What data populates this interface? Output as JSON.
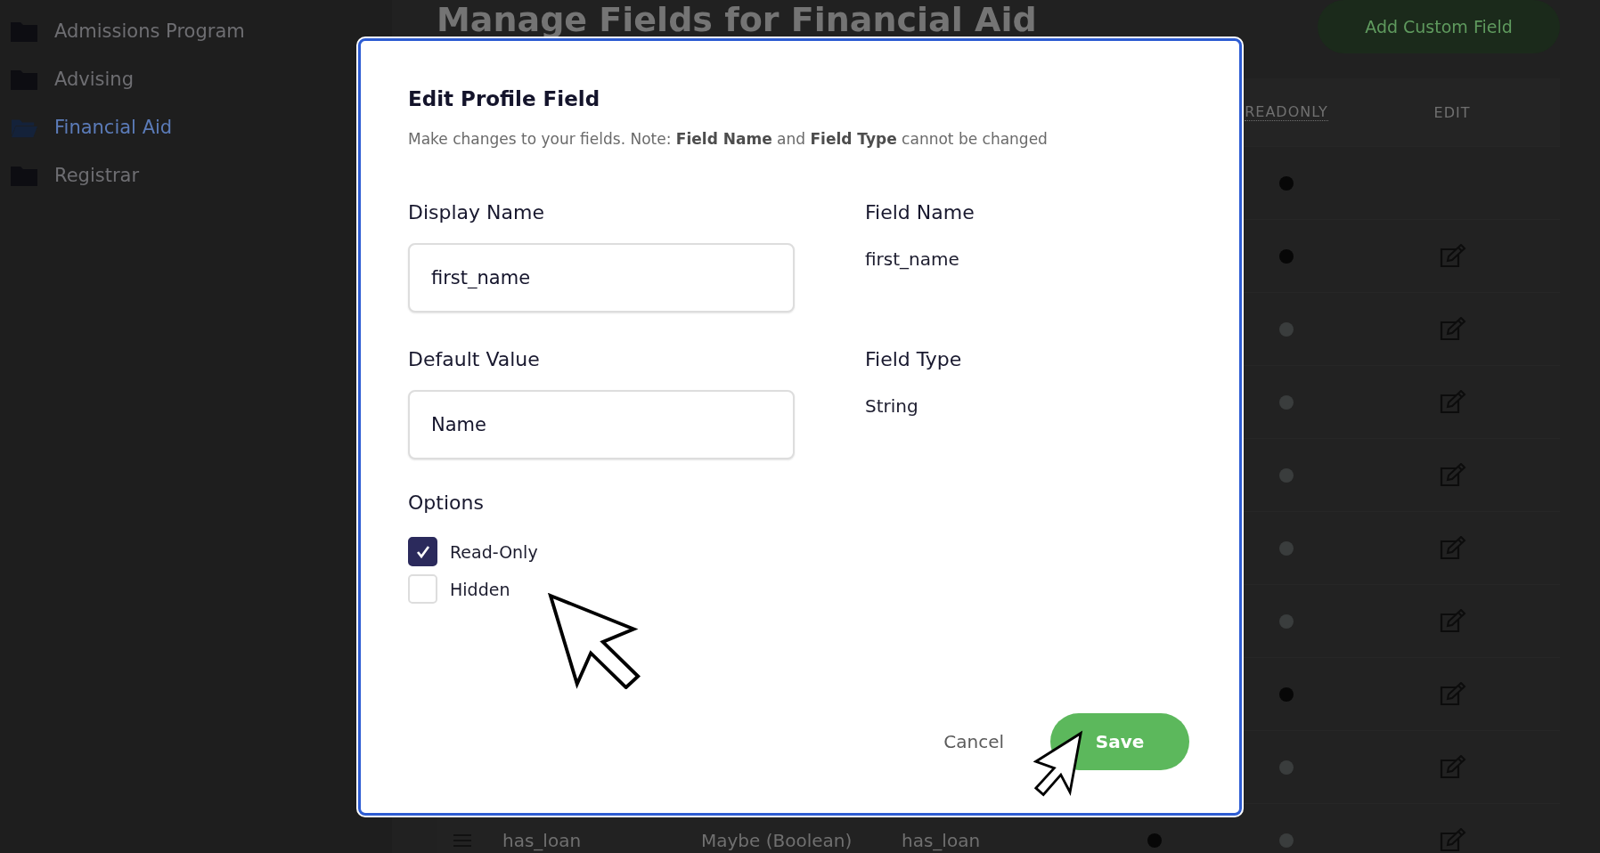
{
  "sidebar": {
    "items": [
      {
        "label": "Admissions Program",
        "selected": false
      },
      {
        "label": "Advising",
        "selected": false
      },
      {
        "label": "Financial Aid",
        "selected": true
      },
      {
        "label": "Registrar",
        "selected": false
      }
    ]
  },
  "page": {
    "title": "Manage Fields for Financial Aid",
    "add_button": "Add Custom Field"
  },
  "table": {
    "columns": [
      {
        "label": "READONLY"
      },
      {
        "label": "EDIT"
      }
    ],
    "rows": [
      {
        "readonly": true,
        "edit": false
      },
      {
        "readonly": true,
        "edit": true
      },
      {
        "readonly": false,
        "edit": true
      },
      {
        "readonly": false,
        "edit": true
      },
      {
        "readonly": false,
        "edit": true
      },
      {
        "readonly": false,
        "edit": true
      },
      {
        "readonly": false,
        "edit": true
      },
      {
        "readonly": true,
        "edit": true
      },
      {
        "readonly": false,
        "edit": true
      },
      {
        "name": "has_loan",
        "type": "Maybe (Boolean)",
        "field": "has_loan",
        "column_5": true,
        "readonly": false,
        "edit": true
      }
    ]
  },
  "dialog": {
    "title": "Edit Profile Field",
    "subtitle": "Make changes to your fields. Note: **Field Name** and **Field Type** cannot be changed",
    "fields": [
      {
        "label": "Display Name",
        "value": "first_name",
        "kind": "input"
      },
      {
        "label": "Field Name",
        "value": "first_name",
        "kind": "static"
      },
      {
        "label": "Default Value",
        "value": "Name",
        "kind": "input"
      },
      {
        "label": "Field Type",
        "value": "String",
        "kind": "static"
      }
    ],
    "options_label": "Options",
    "options": [
      {
        "label": "Read-Only",
        "checked": true
      },
      {
        "label": "Hidden",
        "checked": false
      }
    ],
    "cancel": "Cancel",
    "save": "Save"
  }
}
